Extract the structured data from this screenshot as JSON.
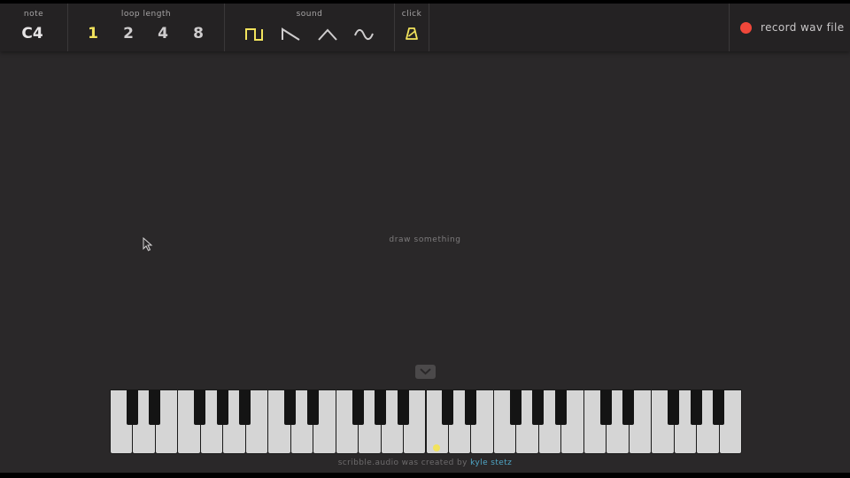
{
  "toolbar": {
    "note": {
      "label": "note",
      "value": "C4"
    },
    "loop_length": {
      "label": "loop length",
      "options": [
        "1",
        "2",
        "4",
        "8"
      ],
      "selected": "1"
    },
    "sound": {
      "label": "sound",
      "options": [
        "square-wave-icon",
        "sawtooth-wave-icon",
        "triangle-wave-icon",
        "sine-wave-icon"
      ],
      "selected": "square-wave-icon"
    },
    "click": {
      "label": "click",
      "icon": "metronome-icon",
      "enabled": true
    },
    "record": {
      "label": "record wav file",
      "icon": "record-dot-icon"
    }
  },
  "canvas": {
    "hint": "draw something"
  },
  "keyboard": {
    "white_keys": 28,
    "active_key": "C4",
    "toggle_icon": "chevron-down-icon"
  },
  "footer": {
    "text": "scribble.audio was created by ",
    "link": "kyle stetz"
  },
  "colors": {
    "background": "#2a2829",
    "toolbar": "#242223",
    "accent": "#f2e35c",
    "record": "#f0473a",
    "link": "#4fa6c6",
    "white_key": "#d5d5d5",
    "black_key": "#141414"
  }
}
